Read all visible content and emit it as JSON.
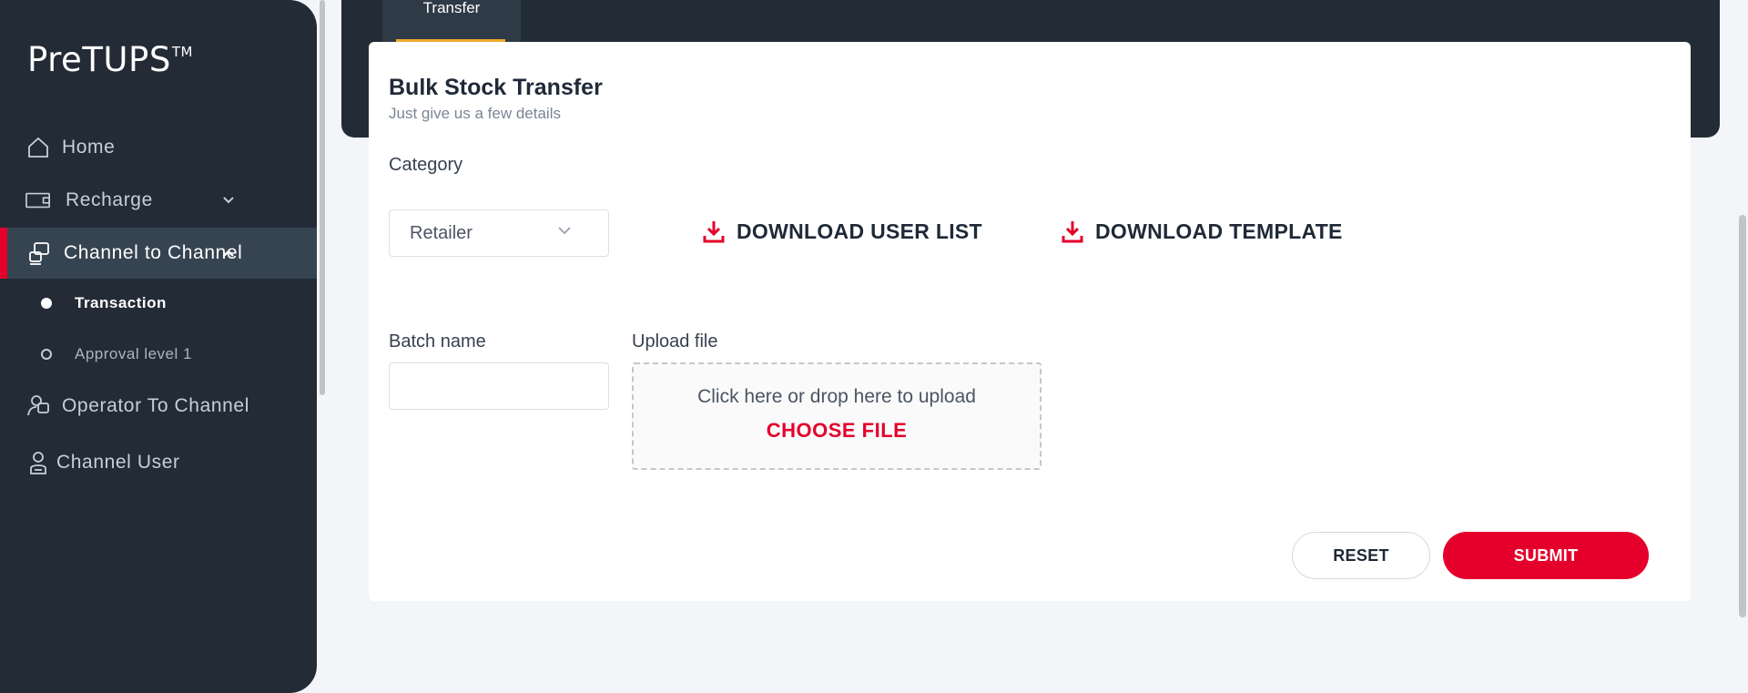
{
  "sidebar": {
    "brand": "PreTUPS",
    "brand_mark": "TM",
    "items": [
      {
        "label": "Home",
        "icon": "home-icon"
      },
      {
        "label": "Recharge",
        "icon": "wallet-icon"
      },
      {
        "label": "Channel to Channel",
        "icon": "transfer-icon"
      },
      {
        "label": "Operator To Channel",
        "icon": "operator-icon"
      },
      {
        "label": "Channel User",
        "icon": "user-icon"
      }
    ],
    "subitems": [
      {
        "label": "Transaction"
      },
      {
        "label": "Approval level 1"
      }
    ]
  },
  "header": {
    "tab_label": "Transfer"
  },
  "form": {
    "title": "Bulk Stock Transfer",
    "subtitle": "Just give us a few details",
    "category_label": "Category",
    "category_value": "Retailer",
    "download_user_list": "DOWNLOAD USER LIST",
    "download_template": "DOWNLOAD TEMPLATE",
    "batch_label": "Batch name",
    "batch_value": "",
    "upload_label": "Upload file",
    "upload_hint": "Click here or drop here to upload",
    "choose_file": "CHOOSE FILE",
    "reset_label": "RESET",
    "submit_label": "SUBMIT"
  },
  "colors": {
    "sidebar_bg": "#222b36",
    "accent": "#e4002b",
    "tab_underline": "#f0a92c"
  }
}
